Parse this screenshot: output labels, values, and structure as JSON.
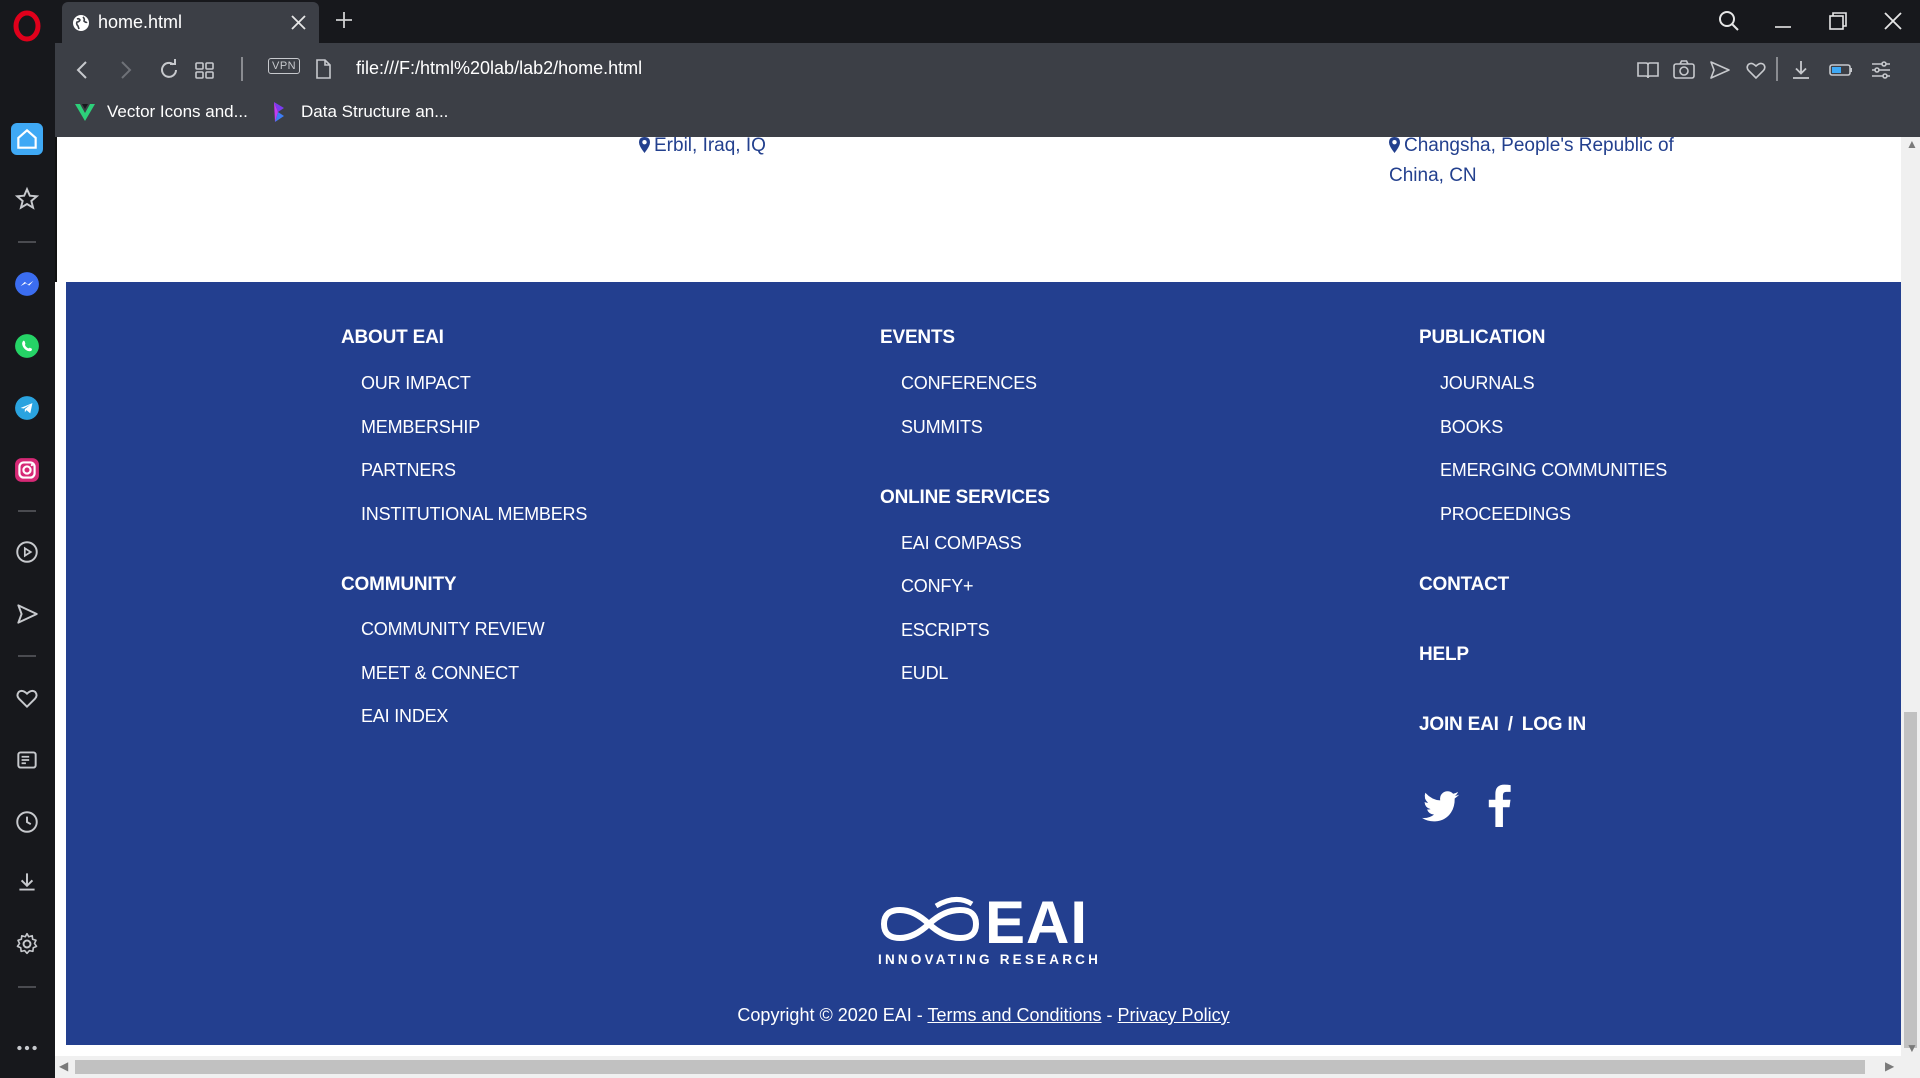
{
  "browser": {
    "tab_title": "home.html",
    "url": "file:///F:/html%20lab/lab2/home.html",
    "vpn_label": "VPN",
    "bookmarks": [
      {
        "label": "Vector Icons and..."
      },
      {
        "label": "Data Structure an..."
      }
    ],
    "sidebar_icons": [
      "opera-logo",
      "home-icon",
      "star-icon",
      "messenger-icon",
      "whatsapp-icon",
      "telegram-icon",
      "instagram-icon",
      "player-icon",
      "send-icon",
      "heart-icon",
      "news-icon",
      "history-icon",
      "download-icon",
      "settings-icon",
      "more-icon"
    ]
  },
  "locations": {
    "erbil": "Erbil, Iraq, IQ",
    "changsha_line1": "Changsha, People's Republic of",
    "changsha_line2": "China, CN"
  },
  "footer": {
    "about": {
      "heading": "ABOUT EAI",
      "items": [
        "OUR IMPACT",
        "MEMBERSHIP",
        "PARTNERS",
        "INSTITUTIONAL MEMBERS"
      ]
    },
    "community": {
      "heading": "COMMUNITY",
      "items": [
        "COMMUNITY REVIEW",
        "MEET & CONNECT",
        "EAI INDEX"
      ]
    },
    "events": {
      "heading": "EVENTS",
      "items": [
        "CONFERENCES",
        "SUMMITS"
      ]
    },
    "online_services": {
      "heading": "ONLINE SERVICES",
      "items": [
        "EAI COMPASS",
        "CONFY+",
        "ESCRIPTS",
        "EUDL"
      ]
    },
    "publication": {
      "heading": "PUBLICATION",
      "items": [
        "JOURNALS",
        "BOOKS",
        "EMERGING COMMUNITIES",
        "PROCEEDINGS"
      ]
    },
    "contact": "CONTACT",
    "help": "HELP",
    "join": "JOIN EAI",
    "slash": "/",
    "login": "LOG IN",
    "logo_text": "EAI",
    "logo_tagline": "INNOVATING RESEARCH",
    "copyright_prefix": "Copyright © 2020 EAI - ",
    "terms": "Terms and Conditions",
    "dash": " - ",
    "privacy": "Privacy Policy"
  },
  "colors": {
    "footer_bg": "#233f8f",
    "link_blue": "#23408e",
    "chrome_dark": "#17181c",
    "chrome_toolbar": "#3c3f46"
  }
}
